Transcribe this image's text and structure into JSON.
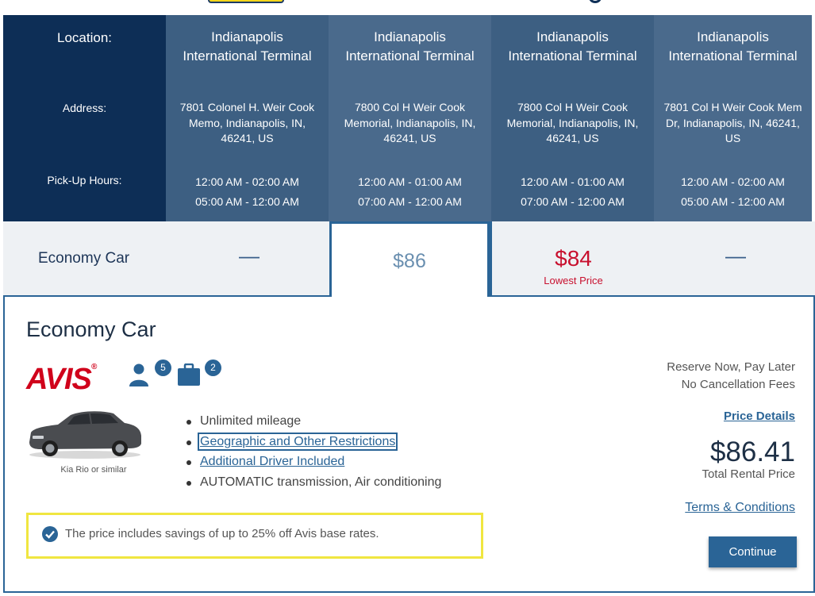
{
  "header": {
    "label_location": "Location:",
    "label_address": "Address:",
    "label_hours": "Pick-Up Hours:"
  },
  "locations": [
    {
      "name": "Indianapolis International Terminal",
      "address": "7801 Colonel H. Weir Cook Memo, Indianapolis, IN, 46241, US",
      "hours": [
        "12:00 AM - 02:00 AM",
        "05:00 AM - 12:00 AM"
      ],
      "price": "—"
    },
    {
      "name": "Indianapolis International Terminal",
      "address": "7800 Col H Weir Cook Memorial, Indianapolis, IN, 46241, US",
      "hours": [
        "12:00 AM - 01:00 AM",
        "07:00 AM - 12:00 AM"
      ],
      "price": "$86"
    },
    {
      "name": "Indianapolis International Terminal",
      "address": "7800 Col H Weir Cook Memorial, Indianapolis, IN, 46241, US",
      "hours": [
        "12:00 AM - 01:00 AM",
        "07:00 AM - 12:00 AM"
      ],
      "price": "$84",
      "note": "Lowest Price"
    },
    {
      "name": "Indianapolis International Terminal",
      "address": "7801 Col H Weir Cook Mem Dr, Indianapolis, IN, 46241, US",
      "hours": [
        "12:00 AM - 02:00 AM",
        "05:00 AM - 12:00 AM"
      ],
      "price": "—"
    }
  ],
  "price_row": {
    "category": "Economy Car"
  },
  "detail": {
    "title": "Economy Car",
    "brand": "AVIS",
    "brand_mark": "®",
    "passengers": "5",
    "bags": "2",
    "car_caption": "Kia Rio or similar",
    "features": [
      "Unlimited mileage",
      "Geographic and Other Restrictions",
      "Additional Driver Included",
      "AUTOMATIC transmission, Air conditioning"
    ],
    "savings": "The price includes savings of up to 25% off Avis base rates.",
    "reserve_line1": "Reserve Now, Pay Later",
    "reserve_line2": "No Cancellation Fees",
    "price_details": "Price Details",
    "total": "$86.41",
    "total_label": "Total Rental Price",
    "terms": "Terms & Conditions",
    "continue": "Continue"
  },
  "colors": {
    "navy": "#0d2e56",
    "column": "#3d5f82",
    "accent": "#2a6496",
    "lowest": "#c8102e",
    "avis_red": "#d0021b",
    "savings_border": "#f0e640"
  },
  "icons": [
    "passenger-icon",
    "luggage-icon",
    "checkmark-icon"
  ]
}
